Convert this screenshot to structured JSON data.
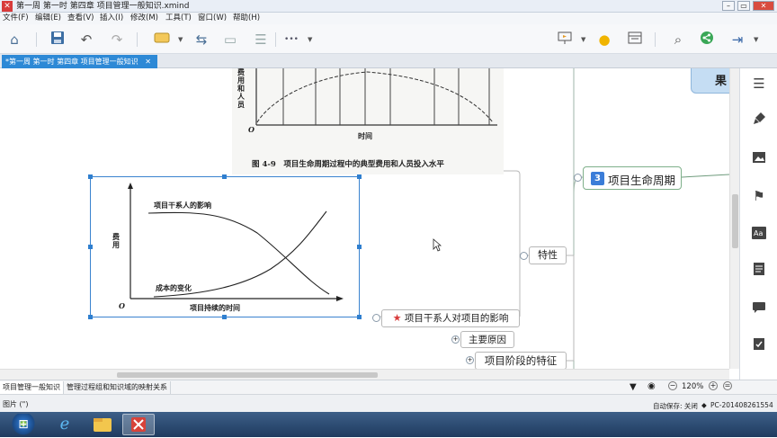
{
  "window": {
    "title": "第一周 第一时 第四章 项目管理一般知识.xmind",
    "app_icon": "✕",
    "controls": [
      "–",
      "▭",
      "✕"
    ]
  },
  "menu": [
    "文件(F)",
    "编辑(E)",
    "查看(V)",
    "插入(I)",
    "修改(M)",
    "工具(T)",
    "窗口(W)",
    "帮助(H)"
  ],
  "toolbar": {
    "icons": [
      "home-icon",
      "save-icon",
      "undo-icon",
      "redo-icon",
      "topic-icon",
      "relationship-icon",
      "boundary-icon",
      "summary-icon",
      "more-icon",
      "present-icon",
      "idea-icon",
      "layout-icon",
      "search-icon",
      "share-icon",
      "export-icon"
    ],
    "more_glyph": "•••"
  },
  "tab": {
    "label": "*第一周 第一时 第四章 项目管理一般知识",
    "close": "✕"
  },
  "canvas": {
    "upper_figure": {
      "ylabel": "费用和人员",
      "origin": "O",
      "xlabel": "时间",
      "caption": "图 4-9　项目生命周期过程中的典型费用和人员投入水平"
    },
    "selected_figure": {
      "series_top": "项目干系人的影响",
      "series_bottom": "成本的变化",
      "ylabel": "费用",
      "xlabel": "项目持续的时间",
      "origin": "O"
    },
    "nodes": {
      "lifecycle_number": "3",
      "lifecycle": "项目生命周期",
      "feature": "特性",
      "stakeholder": "项目干系人对项目的影响",
      "main_reason": "主要原因",
      "phase_feature": "项目阶段的特征",
      "partial_top": "果"
    }
  },
  "right_panel": [
    "outline-icon",
    "format-icon",
    "image-icon",
    "marker-icon",
    "font-icon",
    "notes-icon",
    "comment-icon",
    "task-icon"
  ],
  "sheets": [
    "项目管理一般知识",
    "管理过程组和知识域的映射关系"
  ],
  "status": {
    "left": "图片 (\")",
    "zoom": "120%",
    "autosave": "自动保存: 关闭",
    "user": "PC-201408261554"
  },
  "taskbar": {
    "start": "⊞"
  },
  "colors": {
    "accent": "#2d89d6",
    "badge": "#3b7dd8",
    "star": "#d83a3a"
  }
}
